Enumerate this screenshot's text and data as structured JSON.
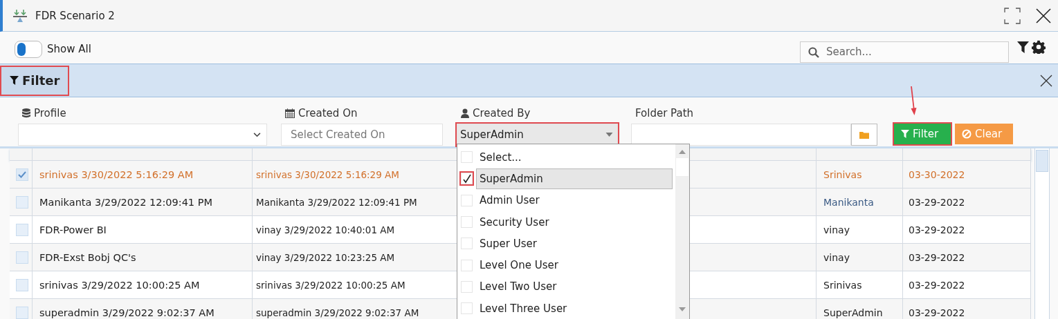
{
  "window": {
    "title": "FDR Scenario 2"
  },
  "toolbar": {
    "show_all": {
      "label": "Show All",
      "on": false
    },
    "search": {
      "placeholder": "Search..."
    }
  },
  "filter_panel": {
    "title": "Filter",
    "highlighted": true,
    "fields": [
      {
        "kind": "select",
        "label": "Profile"
      },
      {
        "kind": "date",
        "label": "Created On",
        "placeholder": "Select Created On"
      },
      {
        "kind": "multiselect",
        "label": "Created By",
        "value": "SuperAdmin",
        "highlighted": true,
        "options": [
          {
            "label": "Select...",
            "checked": false,
            "selected": false
          },
          {
            "label": "SuperAdmin",
            "checked": true,
            "selected": true
          },
          {
            "label": "Admin User",
            "checked": false,
            "selected": false
          },
          {
            "label": "Security User",
            "checked": false,
            "selected": false
          },
          {
            "label": "Super User",
            "checked": false,
            "selected": false
          },
          {
            "label": "Level One User",
            "checked": false,
            "selected": false
          },
          {
            "label": "Level Two User",
            "checked": false,
            "selected": false
          },
          {
            "label": "Level Three User",
            "checked": false,
            "selected": false
          }
        ]
      },
      {
        "kind": "folder",
        "label": "Folder Path"
      }
    ],
    "buttons": [
      {
        "kind": "apply",
        "label": "Filter",
        "highlighted": true
      },
      {
        "kind": "clear",
        "label": "Clear",
        "highlighted": false
      }
    ]
  },
  "table": {
    "rows": [
      {
        "selected": true,
        "hovered": false,
        "name": "srinivas 3/30/2022 5:16:29 AM",
        "created": "srinivas 3/30/2022 5:16:29 AM",
        "creator": "Srinivas",
        "date": "03-30-2022"
      },
      {
        "selected": false,
        "hovered": true,
        "name": "Manikanta 3/29/2022 12:09:41 PM",
        "created": "Manikanta 3/29/2022 12:09:41 PM",
        "creator": "Manikanta",
        "date": "03-29-2022"
      },
      {
        "selected": false,
        "hovered": false,
        "name": "FDR-Power BI",
        "created": "vinay 3/29/2022 10:40:01 AM",
        "creator": "vinay",
        "date": "03-29-2022"
      },
      {
        "selected": false,
        "hovered": false,
        "name": "FDR-Exst Bobj QC's",
        "created": "vinay 3/29/2022 10:23:25 AM",
        "creator": "vinay",
        "date": "03-29-2022"
      },
      {
        "selected": false,
        "hovered": false,
        "name": "srinivas 3/29/2022 10:00:25 AM",
        "created": "srinivas 3/29/2022 10:00:25 AM",
        "creator": "Srinivas",
        "date": "03-29-2022"
      },
      {
        "selected": false,
        "hovered": false,
        "name": "superadmin 3/29/2022 9:02:37 AM",
        "created": "superadmin 3/29/2022 9:02:37 AM",
        "creator": "SuperAdmin",
        "date": "03-29-2022"
      }
    ]
  }
}
